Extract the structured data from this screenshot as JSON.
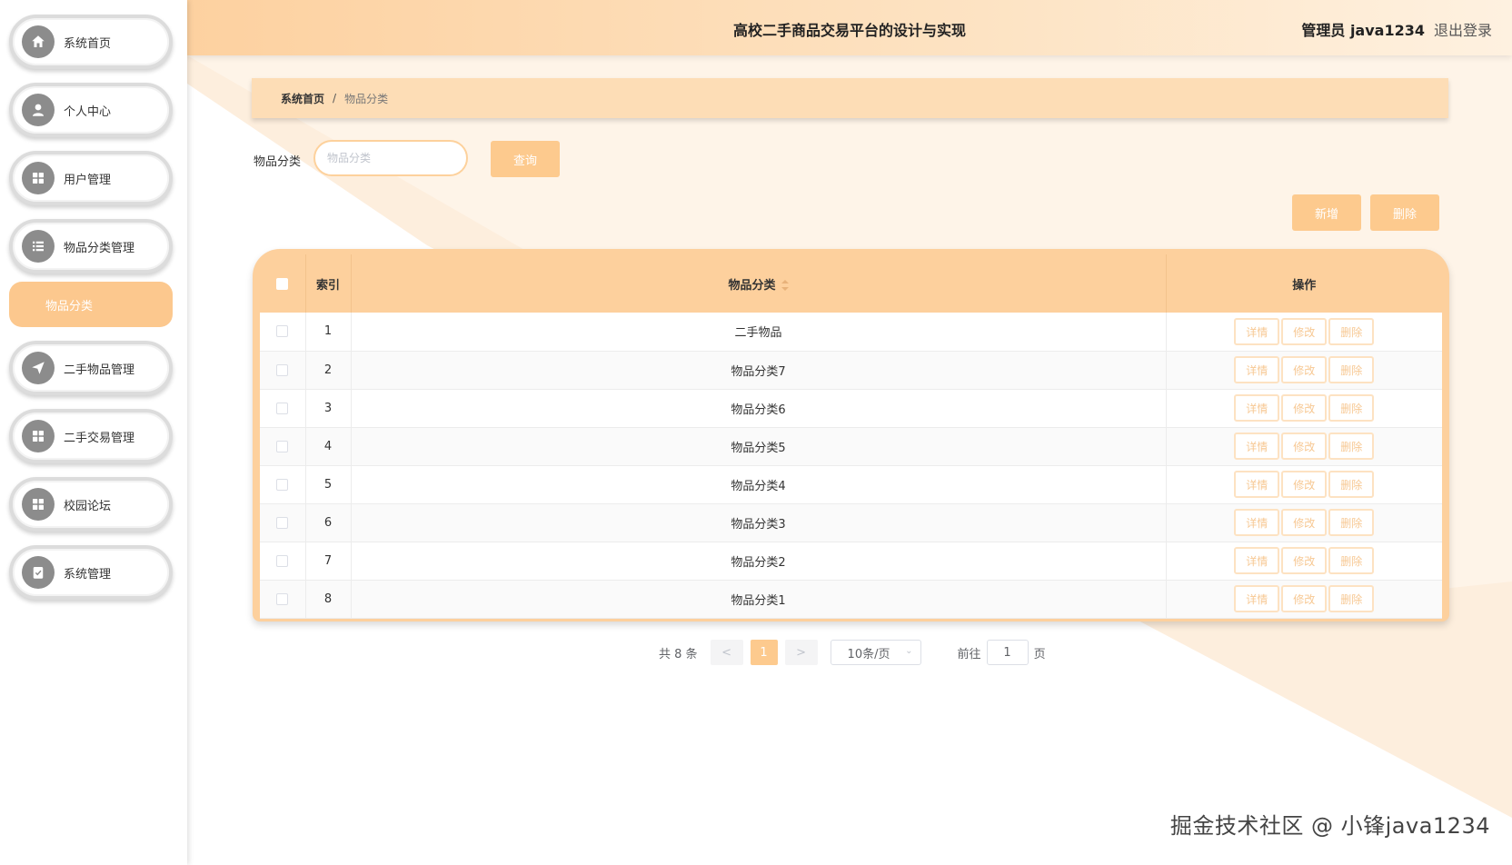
{
  "header": {
    "title": "高校二手商品交易平台的设计与实现",
    "user": "管理员 java1234",
    "logout": "退出登录"
  },
  "sidebar": {
    "items": [
      {
        "label": "系统首页",
        "icon": "home-icon"
      },
      {
        "label": "个人中心",
        "icon": "user-icon"
      },
      {
        "label": "用户管理",
        "icon": "grid-icon"
      },
      {
        "label": "物品分类管理",
        "icon": "list-icon"
      },
      {
        "label": "二手物品管理",
        "icon": "send-icon"
      },
      {
        "label": "二手交易管理",
        "icon": "grid-icon"
      },
      {
        "label": "校园论坛",
        "icon": "grid-icon"
      },
      {
        "label": "系统管理",
        "icon": "clipboard-icon"
      }
    ],
    "active_submenu": "物品分类"
  },
  "breadcrumb": {
    "home": "系统首页",
    "separator": "/",
    "current": "物品分类"
  },
  "search": {
    "label": "物品分类",
    "placeholder": "物品分类",
    "value": "",
    "query_button": "查询"
  },
  "actions": {
    "add": "新增",
    "delete": "删除"
  },
  "table": {
    "headers": [
      "索引",
      "物品分类",
      "操作"
    ],
    "rows": [
      {
        "index": "1",
        "category": "二手物品"
      },
      {
        "index": "2",
        "category": "物品分类7"
      },
      {
        "index": "3",
        "category": "物品分类6"
      },
      {
        "index": "4",
        "category": "物品分类5"
      },
      {
        "index": "5",
        "category": "物品分类4"
      },
      {
        "index": "6",
        "category": "物品分类3"
      },
      {
        "index": "7",
        "category": "物品分类2"
      },
      {
        "index": "8",
        "category": "物品分类1"
      }
    ],
    "row_actions": [
      "详情",
      "修改",
      "删除"
    ]
  },
  "pagination": {
    "total": "共 8 条",
    "prev": "<",
    "current_page": "1",
    "next": ">",
    "page_size": "10条/页",
    "goto_label": "前往",
    "goto_value": "1",
    "page_suffix": "页"
  },
  "watermark": "掘金技术社区 @ 小锋java1234",
  "colors": {
    "accent": "#fdca8e",
    "header_start": "#fdd1a0",
    "table_border": "#fdd09d",
    "breadcrumb_bg": "#fdddb6"
  }
}
